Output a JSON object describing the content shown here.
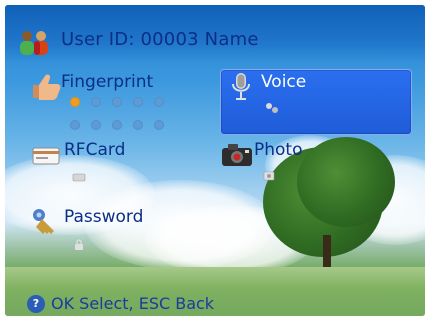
{
  "header": {
    "user_id_text": "User ID: 00003  Name"
  },
  "menu": {
    "fingerprint": {
      "label": "Fingerprint",
      "enrolled_dots": 10,
      "active_dots": 1
    },
    "voice": {
      "label": "Voice",
      "selected": true
    },
    "rfcard": {
      "label": "RFCard"
    },
    "photo": {
      "label": "Photo"
    },
    "password": {
      "label": "Password"
    }
  },
  "footer": {
    "ok_symbol": "?",
    "hint": "OK Select, ESC Back"
  },
  "colors": {
    "label_text": "#0b2f86",
    "highlight": "#1f5cd8",
    "active_dot": "#f29c1f",
    "inactive_dot": "#5c9bd6"
  },
  "icons": {
    "user": "two-people-icon",
    "fingerprint": "thumbs-up-icon",
    "voice": "microphone-icon",
    "rfcard": "card-icon",
    "photo": "camera-icon",
    "password": "keys-icon",
    "ok": "ok-button-icon"
  }
}
